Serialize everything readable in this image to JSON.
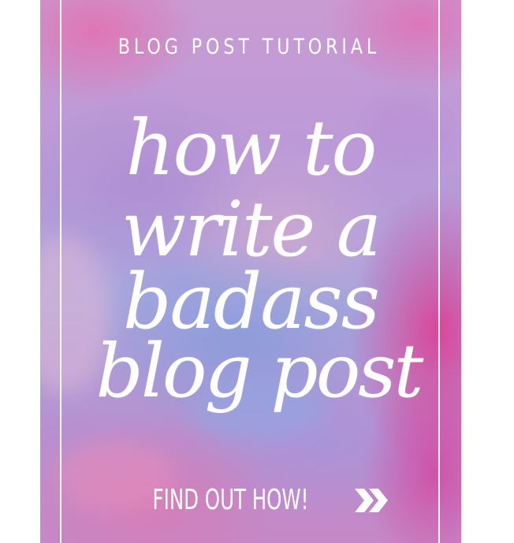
{
  "poster": {
    "kicker": "BLOG POST TUTORIAL",
    "headline_lines": [
      "how to",
      "write a",
      "badass",
      "blog post"
    ],
    "cta_label": "FIND OUT HOW!",
    "cta_icon": "double-chevron-right-icon",
    "colors": {
      "text": "#ffffff",
      "pink": "#e2368e",
      "lavender": "#b89ad8",
      "blue": "#849cdc"
    }
  }
}
